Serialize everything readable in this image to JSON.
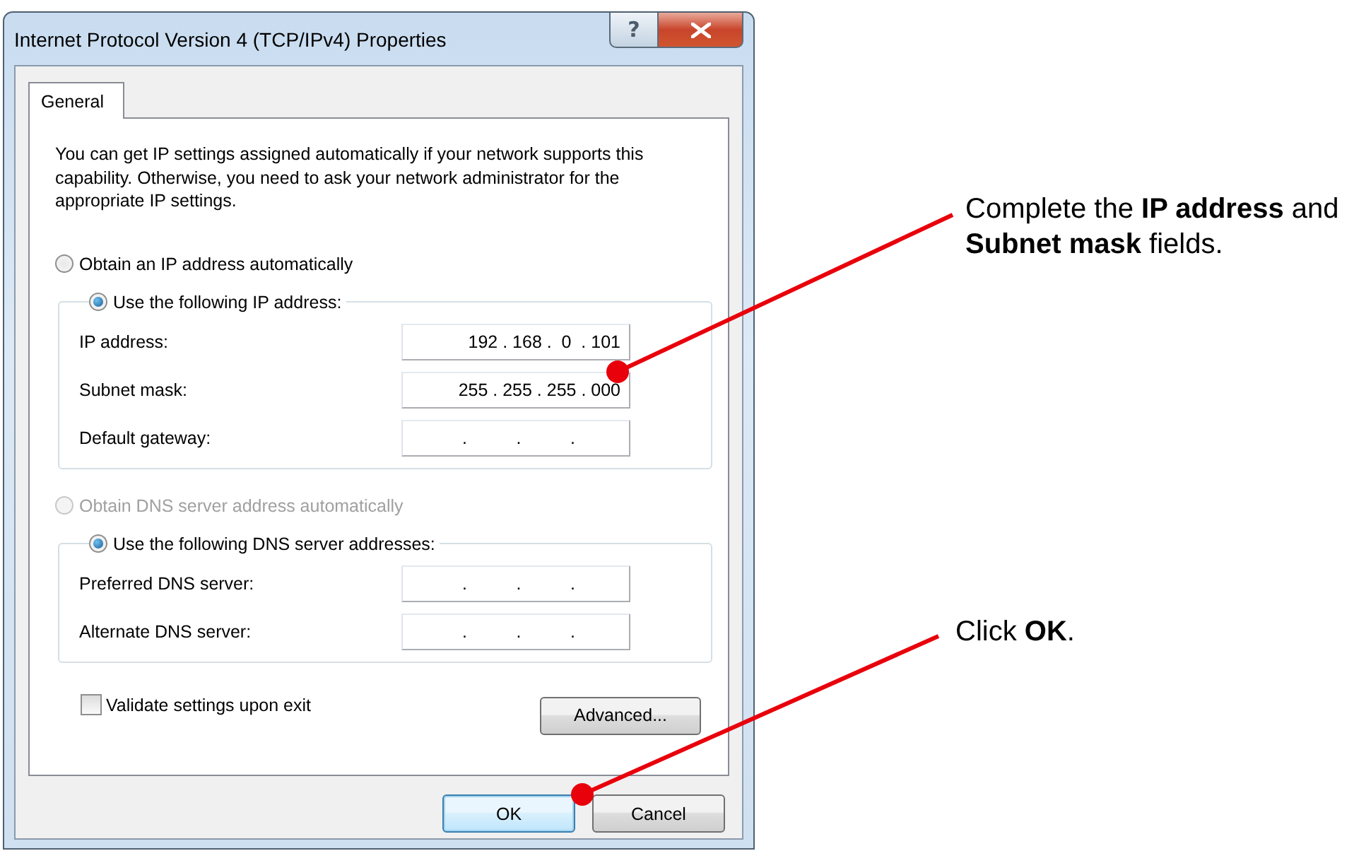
{
  "window": {
    "title": "Internet Protocol Version 4 (TCP/IPv4) Properties",
    "help_label": "?"
  },
  "tabs": [
    {
      "label": "General",
      "selected": true
    }
  ],
  "description": "You can get IP settings assigned automatically if your network supports this capability. Otherwise, you need to ask your network administrator for the appropriate IP settings.",
  "ip_section": {
    "options": [
      {
        "label": "Obtain an IP address automatically",
        "selected": false,
        "disabled": false
      },
      {
        "label": "Use the following IP address:",
        "selected": true,
        "disabled": false
      }
    ],
    "fields": [
      {
        "label": "IP address:",
        "value": "192 . 168 .  0  . 101"
      },
      {
        "label": "Subnet mask:",
        "value": "255 . 255 . 255 . 000"
      },
      {
        "label": "Default gateway:",
        "value": ".          .          ."
      }
    ]
  },
  "dns_section": {
    "options": [
      {
        "label": "Obtain DNS server address automatically",
        "selected": false,
        "disabled": true
      },
      {
        "label": "Use the following DNS server addresses:",
        "selected": true,
        "disabled": false
      }
    ],
    "fields": [
      {
        "label": "Preferred DNS server:",
        "value": ".          .          ."
      },
      {
        "label": "Alternate DNS server:",
        "value": ".          .          ."
      }
    ]
  },
  "validate": {
    "label": "Validate settings upon exit",
    "checked": false
  },
  "advanced_button": "Advanced...",
  "footer_buttons": [
    {
      "label": "OK",
      "default": true
    },
    {
      "label": "Cancel",
      "default": false
    }
  ],
  "callouts": [
    {
      "text": "Complete the **IP address** and **Subnet mask** fields."
    },
    {
      "text": "Click **OK**."
    }
  ]
}
